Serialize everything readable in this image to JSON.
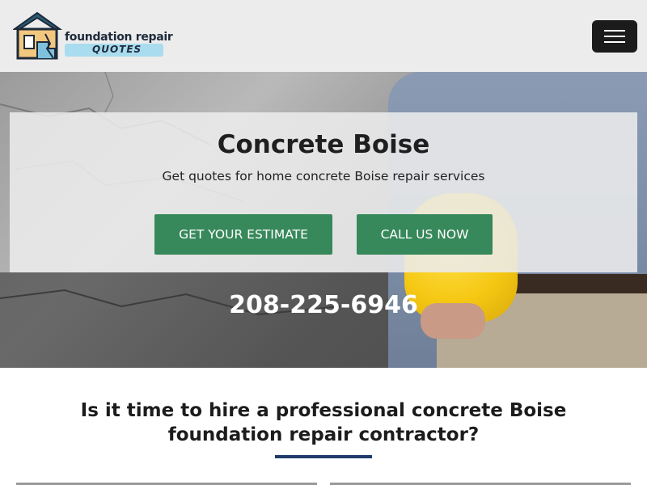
{
  "logo": {
    "line1": "foundation repair",
    "line2": "QUOTES"
  },
  "nav": {
    "menu_icon": "hamburger-menu-icon"
  },
  "hero": {
    "title": "Concrete Boise",
    "subtitle": "Get quotes for home concrete Boise repair services",
    "estimate_label": "GET YOUR ESTIMATE",
    "call_label": "CALL US NOW",
    "phone": "208-225-6946"
  },
  "section": {
    "heading": "Is it time to hire a professional concrete Boise foundation repair contractor?"
  },
  "colors": {
    "button_green": "#37885a",
    "rule_navy": "#1f3a6b",
    "navbar_bg": "#ececec",
    "helmet_yellow": "#f5c814"
  }
}
